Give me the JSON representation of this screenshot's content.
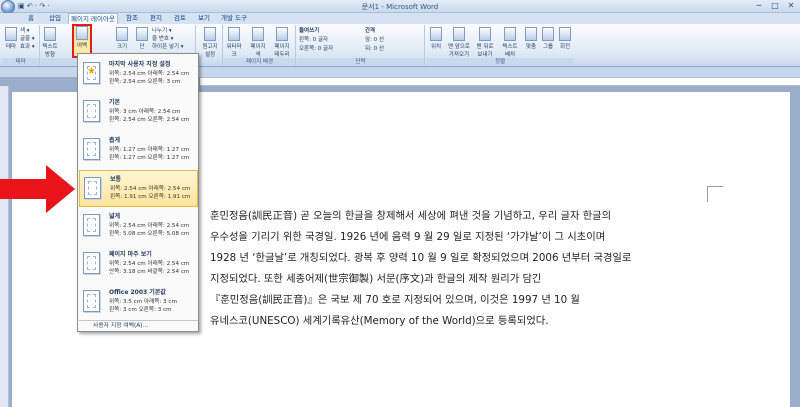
{
  "window": {
    "title": "문서1 - Microsoft Word",
    "controls": [
      "─",
      "□",
      "✕"
    ]
  },
  "qat": "▣ ↶ · ↷ ·",
  "tabs": [
    {
      "label": "홈",
      "active": false
    },
    {
      "label": "삽입",
      "active": false
    },
    {
      "label": "페이지 레이아웃",
      "active": true
    },
    {
      "label": "참조",
      "active": false
    },
    {
      "label": "편지",
      "active": false
    },
    {
      "label": "검토",
      "active": false
    },
    {
      "label": "보기",
      "active": false
    },
    {
      "label": "개발 도구",
      "active": false
    }
  ],
  "ribbon": {
    "groups": {
      "theme": "테마",
      "page_setup": "",
      "page_background": "페이지 배경",
      "paragraph": "단락",
      "arrange": "정렬"
    },
    "theme_button": "테마",
    "theme_colors": "색 ▾",
    "theme_fonts": "글꼴 ▾",
    "theme_effects": "효과 ▾",
    "text_direction": "텍스트 방향",
    "margins_button": "여백",
    "size_button": "크기",
    "columns_button": "단",
    "breaks": "나누기 ▾",
    "line_numbers": "줄 번호 ▾",
    "hyphenation": "하이픈 넣기 ▾",
    "orientation": "용지 방향",
    "watermark": "워터마크",
    "page_color": "페이지 색",
    "page_borders": "페이지 테두리",
    "manuscript": "원고지 설정",
    "indent_title": "들여쓰기",
    "indent_left": "왼쪽: 0 글자",
    "indent_right": "오른쪽: 0 글자",
    "spacing_title": "간격",
    "spacing_before": "앞: 0 선",
    "spacing_after": "뒤: 0 선",
    "position": "위치",
    "front": "맨 앞으로 가져오기",
    "back": "맨 뒤로 보내기",
    "text_wrap": "텍스트 배치",
    "align": "맞춤",
    "group": "그룹",
    "rotate": "회전"
  },
  "margins_menu": {
    "options": [
      {
        "name": "마지막 사용자 지정 설정",
        "r1": "위쪽:    2.54 cm   아래쪽: 2.54 cm",
        "r2": "왼쪽:    2.54 cm   오른쪽: 3 cm",
        "icon": "star-icon"
      },
      {
        "name": "기본",
        "r1": "위쪽:    3 cm        아래쪽: 2.54 cm",
        "r2": "왼쪽:    2.54 cm   오른쪽: 2.54 cm"
      },
      {
        "name": "좁게",
        "r1": "위쪽:    1.27 cm   아래쪽: 1.27 cm",
        "r2": "왼쪽:    1.27 cm   오른쪽: 1.27 cm"
      },
      {
        "name": "보통",
        "r1": "위쪽:    2.54 cm   아래쪽: 2.54 cm",
        "r2": "왼쪽:    1.91 cm   오른쪽: 1.91 cm"
      },
      {
        "name": "넓게",
        "r1": "위쪽:    2.54 cm   아래쪽: 2.54 cm",
        "r2": "왼쪽:    5.08 cm   오른쪽: 5.08 cm"
      },
      {
        "name": "페이지 마주 보기",
        "r1": "위쪽:    2.54 cm   아래쪽: 2.54 cm",
        "r2": "안쪽:    3.18 cm   바깥쪽: 2.54 cm"
      },
      {
        "name": "Office 2003 기본값",
        "r1": "위쪽:    3.5 cm     아래쪽: 3 cm",
        "r2": "왼쪽:    3 cm        오른쪽: 3 cm"
      }
    ],
    "custom": "사용자 지정 여백(A)..."
  },
  "document": {
    "lines": [
      "훈민정음(訓民正音) 곧 오늘의 한글을 창제해서 세상에 펴낸 것을 기념하고, 우리 글자 한글의",
      "우수성을 기리기 위한 국경일. 1926 년에 음력 9 월 29 일로 지정된 ‘가갸날’이 그 시초이며",
      "1928 년 ‘한글날’로 개칭되었다. 광복 후 양력 10 월 9 일로 확정되었으며 2006 년부터 국경일로",
      "지정되었다. 또한 세종어제(世宗御製) 서문(序文)과 한글의 제작 원리가 담긴",
      "『훈민정음(訓民正音)』은 국보 제 70 호로 지정되어 있으며, 이것은 1997 년 10 월",
      "유네스코(UNESCO) 세계기록유산(Memory of the World)으로 등록되었다."
    ]
  }
}
